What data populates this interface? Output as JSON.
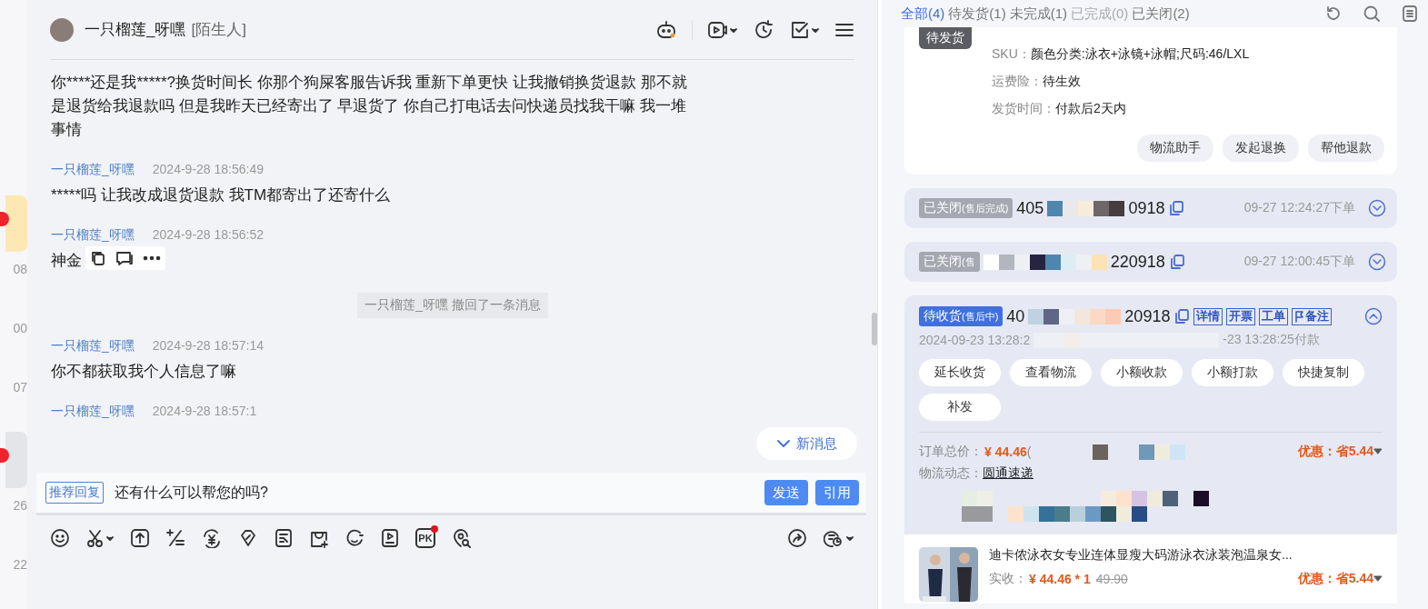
{
  "sidebar": {
    "items": [
      {
        "kind": "unread",
        "selected": false
      },
      {
        "kind": "time",
        "text": "08"
      },
      {
        "kind": "time",
        "text": "00"
      },
      {
        "kind": "time",
        "text": "07"
      },
      {
        "kind": "unread",
        "selected": true
      },
      {
        "kind": "time",
        "text": "26"
      },
      {
        "kind": "time",
        "text": "22"
      }
    ]
  },
  "chat": {
    "contact": {
      "name": "一只榴莲_呀嘿",
      "relation": "[陌生人]"
    },
    "messages": [
      {
        "kind": "text",
        "text": "你****还是我*****?换货时间长 你那个狗屎客服告诉我 重新下单更快 让我撤销换货退款 那不就是退货给我退款吗 但是我昨天已经寄出了 早退货了 你自己打电话去问快递员找我干嘛 我一堆事情"
      },
      {
        "kind": "text",
        "sender": "一只榴莲_呀嘿",
        "time": "2024-9-28 18:56:49",
        "text": "*****吗 让我改成退货退款 我TM都寄出了还寄什么"
      },
      {
        "kind": "text",
        "sender": "一只榴莲_呀嘿",
        "time": "2024-9-28 18:56:52",
        "text": "神金",
        "show_actions": true
      },
      {
        "kind": "recall",
        "text": "一只榴莲_呀嘿 撤回了一条消息"
      },
      {
        "kind": "text",
        "sender": "一只榴莲_呀嘿",
        "time": "2024-9-28 18:57:14",
        "text": "你不都获取我个人信息了嘛"
      },
      {
        "kind": "text",
        "sender": "一只榴莲_呀嘿",
        "time": "2024-9-28 18:57:1"
      }
    ],
    "new_message_button": "新消息",
    "composer": {
      "suggestion_tag": "推荐回复",
      "suggestion": "还有什么可以帮您的吗?",
      "buttons": [
        "发送",
        "引用"
      ]
    },
    "toolbar": {
      "pk_label": "PK",
      "pk_notification": true
    }
  },
  "order_panel": {
    "tabs": [
      {
        "label": "全部(4)",
        "selected": true,
        "disabled": false
      },
      {
        "label": "待发货(1)",
        "selected": false,
        "disabled": false
      },
      {
        "label": "未完成(1)",
        "selected": false,
        "disabled": false
      },
      {
        "label": "已完成(0)",
        "selected": false,
        "disabled": true
      },
      {
        "label": "已关闭(2)",
        "selected": false,
        "disabled": false
      }
    ],
    "current_order": {
      "status_tag": "待发货",
      "fields": [
        {
          "label": "SKU：",
          "value": "颜色分类:泳衣+泳镜+泳帽;尺码:46/LXL"
        },
        {
          "label": "运费险：",
          "value": "待生效"
        },
        {
          "label": "发货时间：",
          "value": "付款后2天内"
        }
      ],
      "actions": [
        "物流助手",
        "发起退换",
        "帮他退款"
      ]
    },
    "orders": [
      {
        "kind": "closed",
        "status": "已关闭",
        "status_note": "(售后完成)",
        "number_start": "405",
        "number_end": "0918",
        "placed": "09-27 12:24:27下单",
        "expanded": false
      },
      {
        "kind": "closed",
        "status": "已关闭",
        "status_note": "(售",
        "number_end": "220918",
        "placed": "09-27 12:00:45下单",
        "expanded": false
      },
      {
        "kind": "active",
        "status": "待收货",
        "status_note": "(售后中)",
        "number_start": "40",
        "number_end": "20918",
        "links": [
          "详情",
          "开票",
          "工单",
          "备注"
        ],
        "expanded": true,
        "time_start": "2024-09-23 13:28:2",
        "time_end": "-23 13:28:25付款",
        "actions": [
          "延长收货",
          "查看物流",
          "小额收款",
          "小额打款",
          "快捷复制",
          "补发"
        ],
        "total_label": "订单总价：",
        "total": "¥ 44.46",
        "total_extra": "(",
        "discount": "优惠：省5.44",
        "logistics_label": "物流动态：",
        "logistics": "圆通速递",
        "product": {
          "title": "迪卡侬泳衣女专业连体显瘦大码游泳衣泳装泡温泉女...",
          "paid_label": "实收：",
          "paid": "¥ 44.46 * 1",
          "original": "49.90",
          "discount": "优惠：省5.44"
        }
      }
    ]
  }
}
